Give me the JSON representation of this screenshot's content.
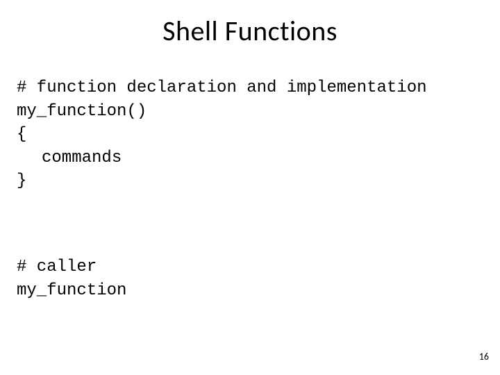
{
  "title": "Shell Functions",
  "block1": {
    "l1": "# function declaration and implementation",
    "l2": "my_function()",
    "l3": "{",
    "l4": "commands",
    "l5": "}"
  },
  "block2": {
    "l1": "# caller",
    "l2": "my_function"
  },
  "page_number": "16"
}
